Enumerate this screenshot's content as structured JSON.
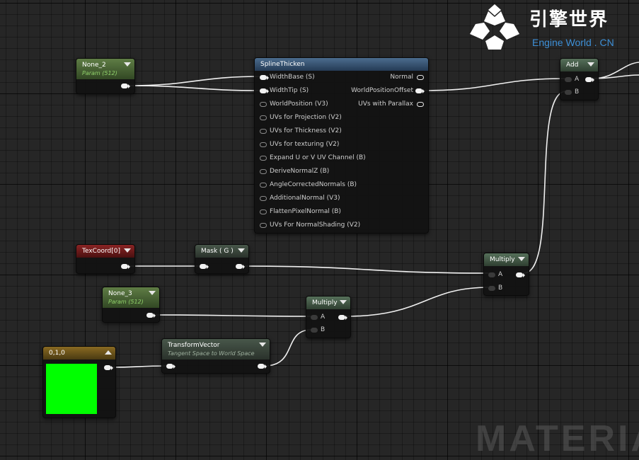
{
  "brand": {
    "name": "引擎世界",
    "subtitle": "Engine World . CN",
    "watermark": "MATERIA"
  },
  "nodes": {
    "none2": {
      "title": "None_2",
      "subtitle": "Param (512)"
    },
    "spline": {
      "title": "SplineThicken",
      "inputs": [
        "WidthBase (S)",
        "WidthTip (S)",
        "WorldPosition (V3)",
        "UVs for Projection (V2)",
        "UVs for Thickness (V2)",
        "UVs for texturing (V2)",
        "Expand U or V UV Channel (B)",
        "DeriveNormalZ (B)",
        "AngleCorrectedNormals (B)",
        "AdditionalNormal (V3)",
        "FlattenPixelNormal (B)",
        "UVs For NormalShading (V2)"
      ],
      "outputs": [
        "Normal",
        "WorldPositionOffset",
        "UVs with Parallax"
      ]
    },
    "add": {
      "title": "Add",
      "inputs": [
        "A",
        "B"
      ]
    },
    "texcoord": {
      "title": "TexCoord[0]"
    },
    "mask": {
      "title": "Mask ( G )"
    },
    "multiply1": {
      "title": "Multiply",
      "inputs": [
        "A",
        "B"
      ]
    },
    "none3": {
      "title": "None_3",
      "subtitle": "Param (512)"
    },
    "multiply2": {
      "title": "Multiply",
      "inputs": [
        "A",
        "B"
      ]
    },
    "constant": {
      "title": "0,1,0"
    },
    "transform": {
      "title": "TransformVector",
      "subtitle": "Tangent Space to World Space"
    }
  },
  "colors": {
    "canvas": "#262626",
    "param_header": "#5f7d45",
    "function_header": "#4b6c8e",
    "texcoord_header": "#8a2424",
    "vector_header": "#8a6a22",
    "swatch": "#00ff00",
    "brand_blue": "#3d8fd6"
  }
}
